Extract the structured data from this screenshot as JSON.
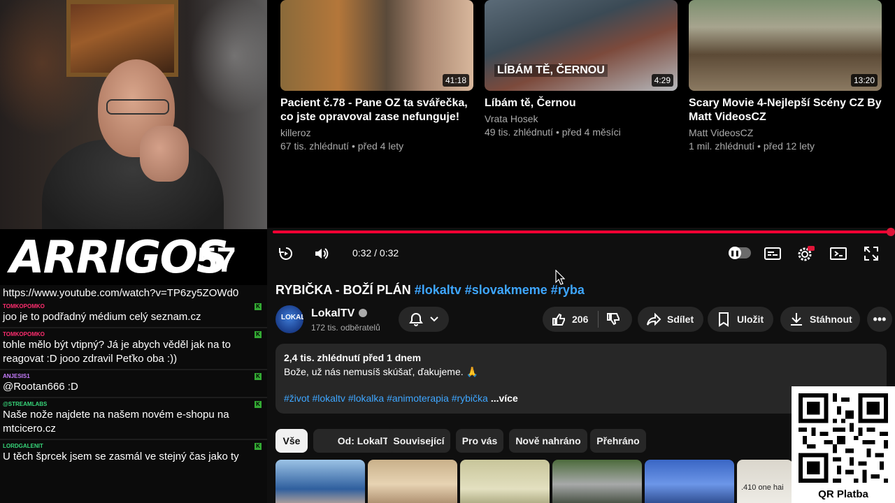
{
  "stream": {
    "brand_name": "ARRIGOS",
    "viewer_count": "57",
    "chat": {
      "pinned_url": "https://www.youtube.com/watch?v=TP6zy5ZOWd0",
      "messages": [
        {
          "user": "TOMKOPOMKO",
          "user_color": "#ff2d6f",
          "text": "joo je to podřadný médium celý seznam.cz"
        },
        {
          "user": "TOMKOPOMKO",
          "user_color": "#ff2d6f",
          "text": "tohle mělo být vtipný? Já je abych věděl jak na to reagovat :D jooo zdravil Peťko oba :))"
        },
        {
          "user": "ANJESIS1",
          "user_color": "#c77dff",
          "text": "@Rootan666 :D"
        },
        {
          "user": "@STREAMLABS",
          "user_color": "#37d67a",
          "text": "Naše nože najdete na našem novém e-shopu na mtcicero.cz"
        },
        {
          "user": "LORDGALENIT",
          "user_color": "#37d67a",
          "text": "U těch šprcek jsem se zasmál ve stejný čas jako ty"
        }
      ]
    }
  },
  "endscreen": {
    "cards": [
      {
        "title": "Pacient č.78 - Pane OZ ta svářečka, co jste opravoval zase nefunguje!",
        "channel": "killeroz",
        "meta": "67 tis. zhlédnutí • před 4 lety",
        "duration": "41:18"
      },
      {
        "title": "Líbám tě, Černou",
        "channel": "Vrata Hosek",
        "meta": "49 tis. zhlédnutí • před 4 měsíci",
        "duration": "4:29",
        "overlay": "LÍBÁM TĚ, ČERNOU"
      },
      {
        "title": "Scary Movie 4-Nejlepší Scény CZ By Matt VideosCZ",
        "channel": "Matt VideosCZ",
        "meta": "1 mil. zhlédnutí • před 12 lety",
        "duration": "13:20"
      }
    ]
  },
  "player": {
    "time": "0:32 / 0:32",
    "progress": 1.0,
    "accent": "#ff0033"
  },
  "video": {
    "title_plain": "RYBIČKA - BOŽÍ PLÁN",
    "title_tags": "#lokaltv #slovakmeme #ryba",
    "channel_name": "LokalTV",
    "subscribers": "172 tis. odběratelů",
    "avatar_text": "LOKAL",
    "likes": "206",
    "share_label": "Sdílet",
    "save_label": "Uložit",
    "download_label": "Stáhnout",
    "description": {
      "stats": "2,4 tis. zhlédnutí  před 1 dnem",
      "text": "Bože, už nás nemusíš skúšať, ďakujeme. 🙏",
      "tags": "#život #lokaltv #lokalka #animoterapia #rybička",
      "more": "...více"
    }
  },
  "chips": [
    "Vše",
    "Od: LokalTV",
    "Související",
    "Pro vás",
    "Nově nahráno",
    "Přehráno"
  ],
  "shorts_overlay": ".410 one hai",
  "qr_label": "QR Platba"
}
